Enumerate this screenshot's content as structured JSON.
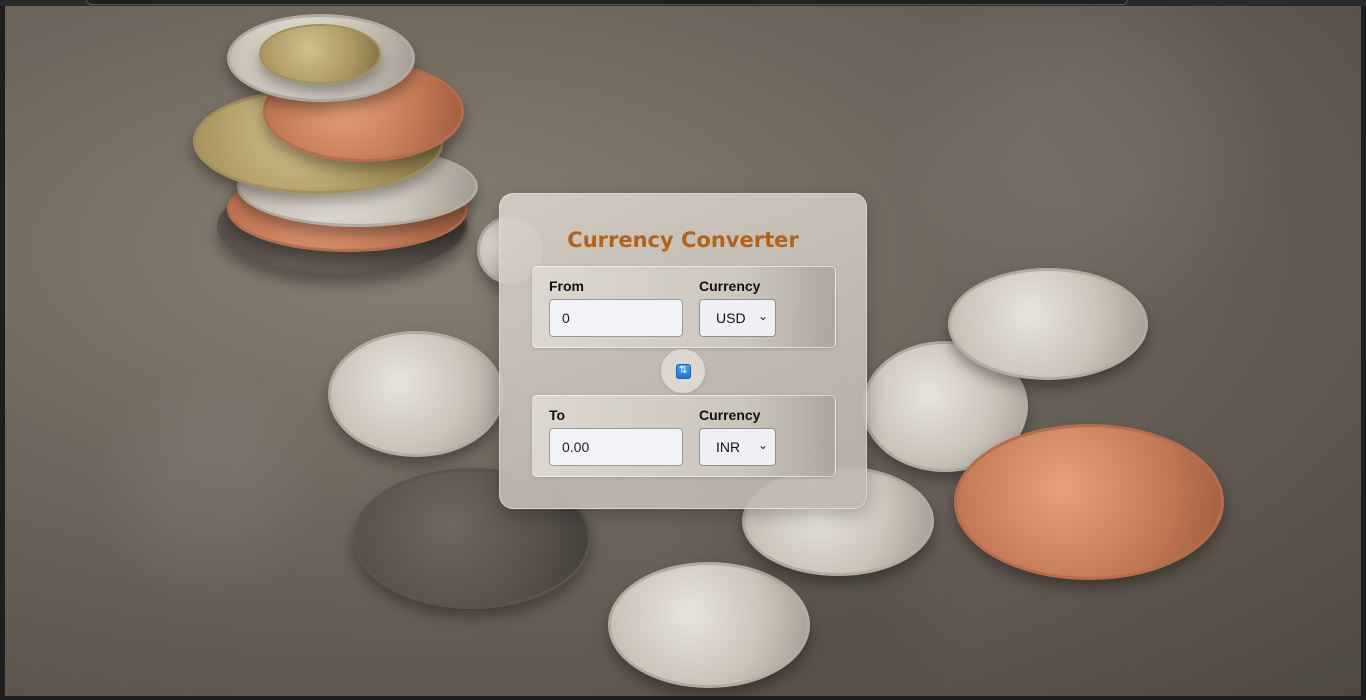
{
  "app": {
    "title": "Currency Converter"
  },
  "from": {
    "label": "From",
    "amount": "0",
    "currency_label": "Currency",
    "currency": "USD"
  },
  "to": {
    "label": "To",
    "amount": "0.00",
    "currency_label": "Currency",
    "currency": "INR"
  },
  "swap": {
    "icon": "swap-arrows-icon",
    "glyph": "⇅"
  },
  "colors": {
    "title": "#b3621c",
    "swap_button": "#1e78d2"
  },
  "background": {
    "icon": "coins-photo"
  }
}
